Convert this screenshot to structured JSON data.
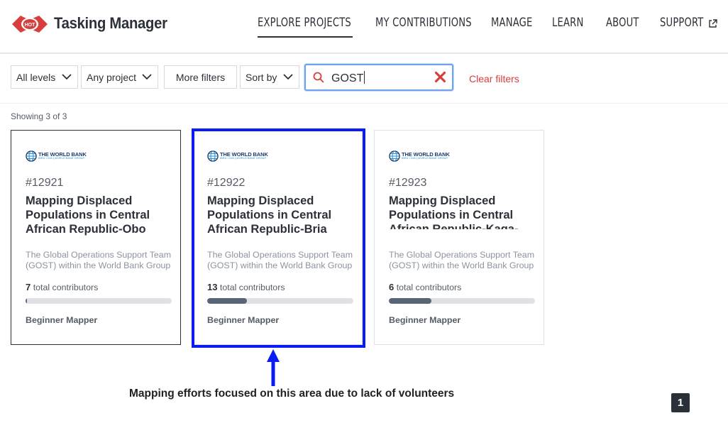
{
  "header": {
    "brand": "Tasking Manager",
    "logo_text": "HOT",
    "nav": [
      {
        "label": "EXPLORE PROJECTS",
        "active": true
      },
      {
        "label": "MY CONTRIBUTIONS"
      },
      {
        "label": "MANAGE"
      },
      {
        "label": "LEARN"
      },
      {
        "label": "ABOUT"
      },
      {
        "label": "SUPPORT",
        "icon": "external-link-icon"
      }
    ]
  },
  "filters": {
    "level": "All levels",
    "project": "Any project",
    "more": "More filters",
    "sort": "Sort by",
    "search_value": "GOST",
    "clear": "Clear filters"
  },
  "results": {
    "showing": "Showing 3 of 3"
  },
  "org_logo": {
    "name": "THE WORLD BANK",
    "sub": "IBRD • IDA | WORLD BANK GROUP"
  },
  "projects": [
    {
      "id": "#12921",
      "title": "Mapping Displaced Populations in Central African Republic-Obo",
      "org": "The Global Operations Support Team (GOST) within the World Bank Group",
      "contributors": "7",
      "contributors_label": "total contributors",
      "progress": 0.01,
      "level": "Beginner Mapper"
    },
    {
      "id": "#12922",
      "title": "Mapping Displaced Populations in Central African Republic-Bria",
      "org": "The Global Operations Support Team (GOST) within the World Bank Group",
      "contributors": "13",
      "contributors_label": "total contributors",
      "progress": 0.27,
      "level": "Beginner Mapper"
    },
    {
      "id": "#12923",
      "title": "Mapping Displaced Populations in Central African Republic-Kaga-Bandoro",
      "org": "The Global Operations Support Team (GOST) within the World Bank Group",
      "contributors": "6",
      "contributors_label": "total contributors",
      "progress": 0.29,
      "level": "Beginner Mapper"
    }
  ],
  "annotation": "Mapping efforts focused on this area due to lack of volunteers",
  "pagination": {
    "current": "1"
  },
  "colors": {
    "accent": "#d73f3f",
    "highlight": "#0a1cf5",
    "progress": "#596574"
  }
}
